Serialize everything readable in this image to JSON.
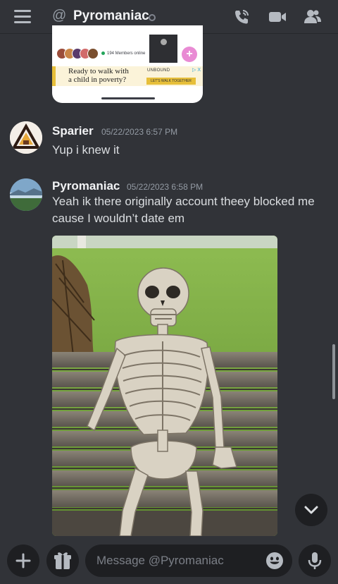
{
  "header": {
    "at_symbol": "@",
    "title": "Pyromaniac",
    "icons": [
      "menu-icon",
      "call-icon",
      "video-icon",
      "members-icon"
    ]
  },
  "embed": {
    "members_online": "194 Members online",
    "ad_text_line1": "Ready to walk with",
    "ad_text_line2": "a child in poverty?",
    "ad_brand": "UNBOUND",
    "ad_cta": "LET'S WALK TOGETHER",
    "ad_chip": "▷ X"
  },
  "messages": [
    {
      "author": "Sparier",
      "timestamp": "05/22/2023 6:57 PM",
      "text": "Yup i knew it"
    },
    {
      "author": "Pyromaniac",
      "timestamp": "05/22/2023 6:58 PM",
      "text": "Yeah ik there originally account theey blocked me cause I wouldn’t date em"
    }
  ],
  "composer": {
    "placeholder": "Message @Pyromaniac"
  },
  "colors": {
    "background": "#313338",
    "input": "#1e1f22",
    "text": "#dbdee1",
    "muted": "#949ba4"
  }
}
